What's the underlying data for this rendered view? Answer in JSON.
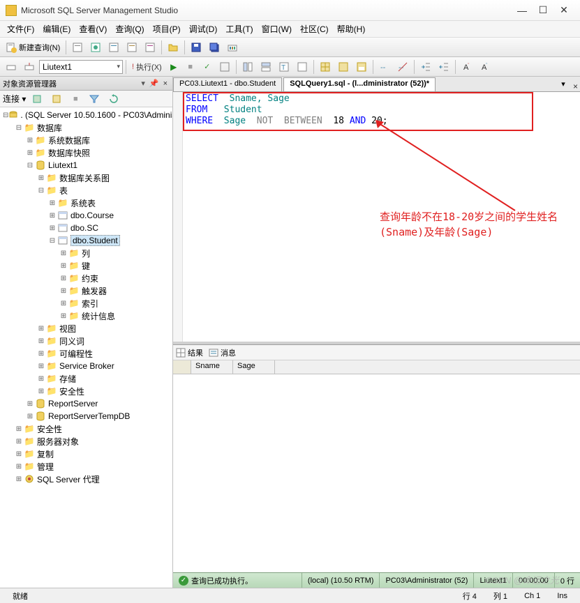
{
  "title": "Microsoft SQL Server Management Studio",
  "menus": [
    "文件(F)",
    "编辑(E)",
    "查看(V)",
    "查询(Q)",
    "项目(P)",
    "调试(D)",
    "工具(T)",
    "窗口(W)",
    "社区(C)",
    "帮助(H)"
  ],
  "toolbar1": {
    "new_query": "新建查询(N)"
  },
  "toolbar2": {
    "db_selected": "Liutext1",
    "execute": "执行(X)"
  },
  "obj_explorer": {
    "title": "对象资源管理器",
    "connect_label": "连接 ▾",
    "root": ". (SQL Server 10.50.1600 - PC03\\Administ",
    "nodes": {
      "databases": "数据库",
      "sys_db": "系统数据库",
      "db_snapshots": "数据库快照",
      "liutext1": "Liutext1",
      "diagrams": "数据库关系图",
      "tables": "表",
      "sys_tables": "系统表",
      "t_course": "dbo.Course",
      "t_sc": "dbo.SC",
      "t_student": "dbo.Student",
      "columns": "列",
      "keys": "键",
      "constraints": "约束",
      "triggers": "触发器",
      "indexes": "索引",
      "stats": "统计信息",
      "views": "视图",
      "synonyms": "同义词",
      "programmability": "可编程性",
      "service_broker": "Service Broker",
      "storage": "存储",
      "security_db": "安全性",
      "report_server": "ReportServer",
      "report_server_temp": "ReportServerTempDB",
      "security": "安全性",
      "server_objects": "服务器对象",
      "replication": "复制",
      "management": "管理",
      "agent": "SQL Server 代理"
    }
  },
  "tabs": {
    "inactive": "PC03.Liutext1 - dbo.Student",
    "active": "SQLQuery1.sql - (l...dministrator (52))*"
  },
  "sql": {
    "line1_kw1": "SELECT",
    "line1_id": "Sname, Sage",
    "line2_kw1": "FROM",
    "line2_id": "Student",
    "line3_kw1": "WHERE",
    "line3_id": "Sage",
    "line3_op1": "NOT",
    "line3_op2": "BETWEEN",
    "line3_n1": "18",
    "line3_kw2": "AND",
    "line3_n2": "20;"
  },
  "annotation": "查询年龄不在18-20岁之间的学生姓名(Sname)及年龄(Sage)",
  "results": {
    "tab_results": "结果",
    "tab_messages": "消息",
    "col1": "Sname",
    "col2": "Sage"
  },
  "query_status": {
    "ok": "查询已成功执行。",
    "server": "(local) (10.50 RTM)",
    "user": "PC03\\Administrator (52)",
    "db": "Liutext1",
    "time": "00:00:00",
    "rows": "0 行"
  },
  "main_status": {
    "ready": "就绪",
    "line": "行 4",
    "col": "列 1",
    "ch": "Ch 1",
    "ins": "Ins"
  },
  "watermark": "CSDN @命运之光"
}
